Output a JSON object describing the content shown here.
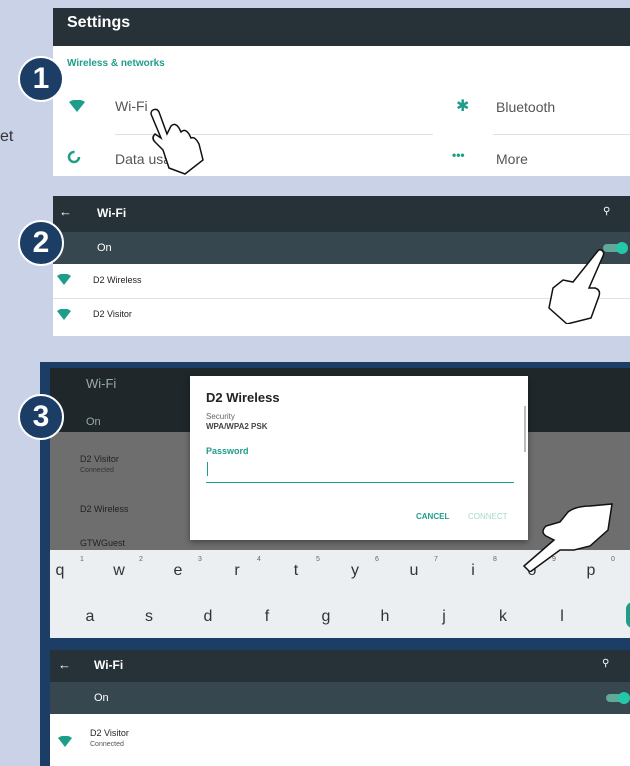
{
  "side_text": "et",
  "panel1": {
    "title": "Settings",
    "section": "Wireless & networks",
    "items": [
      {
        "label": "Wi-Fi",
        "icon": "wifi-icon"
      },
      {
        "label": "Bluetooth",
        "icon": "bluetooth-icon"
      },
      {
        "label": "Data usage",
        "icon": "data-usage-icon"
      },
      {
        "label": "More",
        "icon": "more-icon"
      }
    ],
    "step": "1"
  },
  "panel2": {
    "title": "Wi-Fi",
    "toggle_label": "On",
    "networks": [
      {
        "name": "D2 Wireless"
      },
      {
        "name": "D2 Visitor"
      }
    ],
    "step": "2"
  },
  "panel3": {
    "step": "3",
    "bg_title": "Wi-Fi",
    "bg_toggle": "On",
    "bg_networks": [
      {
        "name": "D2 Visitor",
        "status": "Connected"
      },
      {
        "name": "D2 Wireless",
        "status": ""
      },
      {
        "name": "GTWGuest",
        "status": ""
      }
    ],
    "dialog": {
      "title": "D2 Wireless",
      "security_label": "Security",
      "security_value": "WPA/WPA2 PSK",
      "password_label": "Password",
      "password_value": "",
      "cancel": "CANCEL",
      "connect": "CONNECT"
    },
    "keyboard": {
      "row1": [
        "q",
        "w",
        "e",
        "r",
        "t",
        "y",
        "u",
        "i",
        "o",
        "p"
      ],
      "row1_sub": [
        "1",
        "2",
        "3",
        "4",
        "5",
        "6",
        "7",
        "8",
        "9",
        "0"
      ],
      "row2": [
        "a",
        "s",
        "d",
        "f",
        "g",
        "h",
        "j",
        "k",
        "l"
      ]
    }
  },
  "panel4": {
    "title": "Wi-Fi",
    "toggle_label": "On",
    "network": {
      "name": "D2 Visitor",
      "status": "Connected"
    }
  },
  "colors": {
    "accent": "#1e9e89",
    "header": "#263238",
    "badge": "#1c3d66"
  }
}
